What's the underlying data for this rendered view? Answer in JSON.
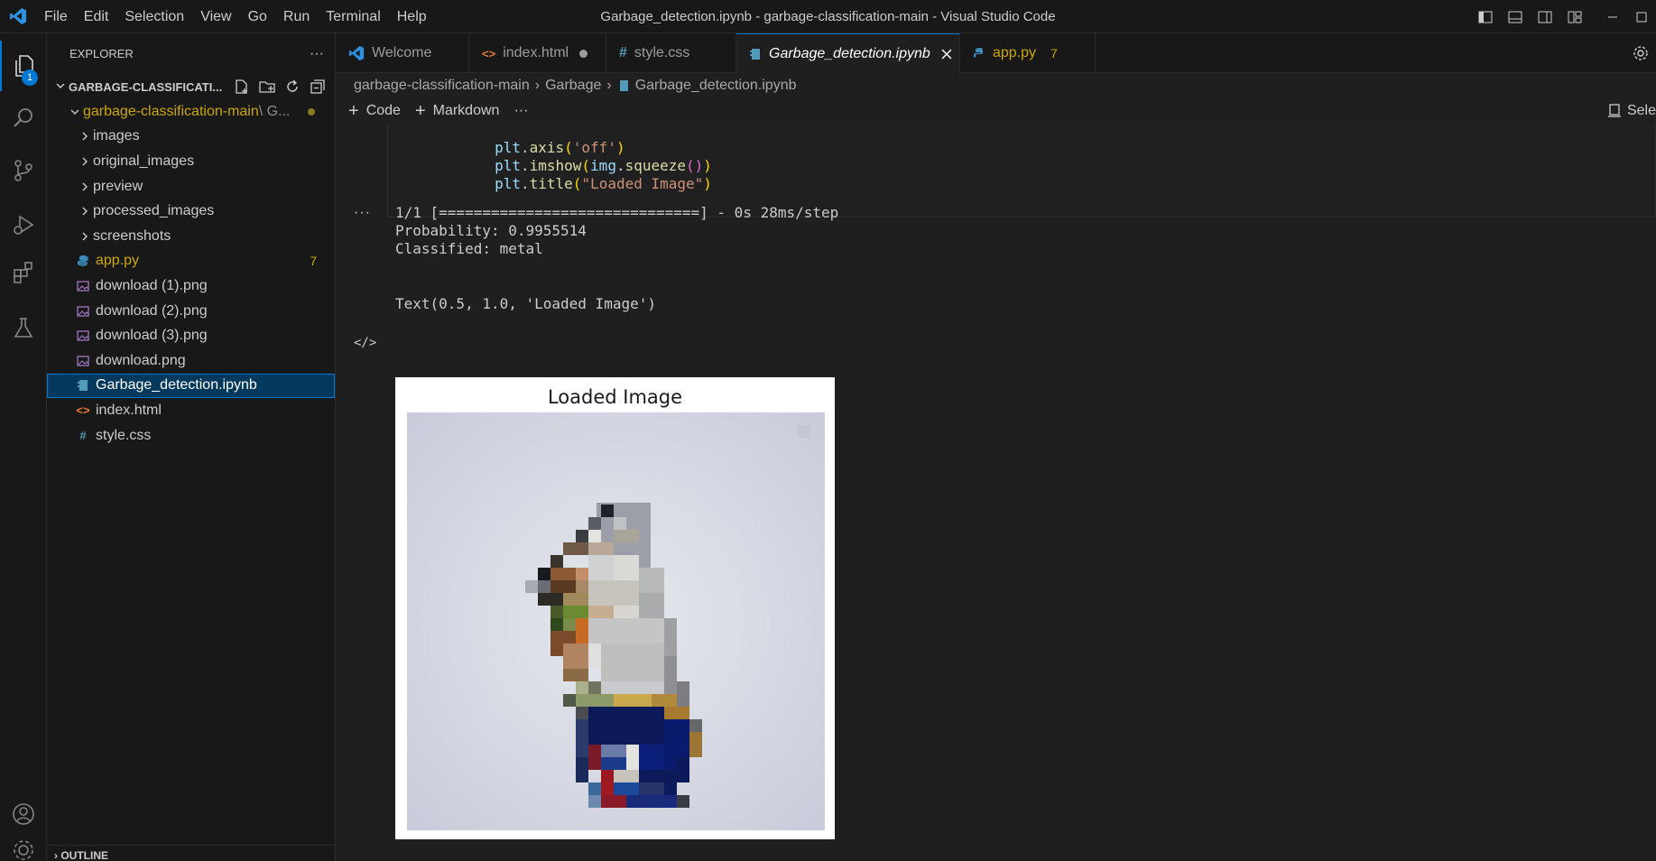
{
  "menu": [
    "File",
    "Edit",
    "Selection",
    "View",
    "Go",
    "Run",
    "Terminal",
    "Help"
  ],
  "window_title": "Garbage_detection.ipynb - garbage-classification-main - Visual Studio Code",
  "activity": {
    "explorer_badge": "1"
  },
  "explorer": {
    "header": "EXPLORER",
    "more": "···",
    "section_title": "GARBAGE-CLASSIFICATI...",
    "root_folder": "garbage-classification-main",
    "root_folder_suffix": "\\ G...",
    "folders": [
      "images",
      "original_images",
      "preview",
      "processed_images",
      "screenshots"
    ],
    "files": [
      {
        "name": "app.py",
        "badge": "7"
      },
      {
        "name": "download (1).png"
      },
      {
        "name": "download (2).png"
      },
      {
        "name": "download (3).png"
      },
      {
        "name": "download.png"
      },
      {
        "name": "Garbage_detection.ipynb"
      },
      {
        "name": "index.html"
      },
      {
        "name": "style.css"
      }
    ],
    "outline": "OUTLINE"
  },
  "tabs": [
    {
      "label": "Welcome"
    },
    {
      "label": "index.html"
    },
    {
      "label": "style.css"
    },
    {
      "label": "Garbage_detection.ipynb"
    },
    {
      "label": "app.py",
      "badge": "7"
    }
  ],
  "breadcrumb": [
    "garbage-classification-main",
    "Garbage",
    "Garbage_detection.ipynb"
  ],
  "notebook_toolbar": {
    "code": "Code",
    "markdown": "Markdown",
    "more": "···",
    "kernel": "Sele"
  },
  "code_lines": [
    {
      "obj": "plt",
      "fn": "axis",
      "arg": "'off'"
    },
    {
      "obj": "plt",
      "fn": "imshow",
      "arg_obj": "img",
      "arg_fn": "squeeze"
    },
    {
      "obj": "plt",
      "fn": "title",
      "arg": "\"Loaded Image\""
    }
  ],
  "output": {
    "more": "···",
    "progress_line": "1/1 [==============================] - 0s 28ms/step",
    "probability_line": "Probability: 0.9955514",
    "classified_line": "Classified: metal",
    "text_repr": "Text(0.5, 1.0, 'Loaded Image')",
    "code_icon": "</>",
    "figure_title": "Loaded Image"
  },
  "colors": {
    "accent": "#0078d4",
    "modified": "#cca700",
    "python_icon": "#3c8dbc",
    "html_icon": "#e37933",
    "css_icon": "#519aba",
    "notebook_icon": "#519aba"
  }
}
